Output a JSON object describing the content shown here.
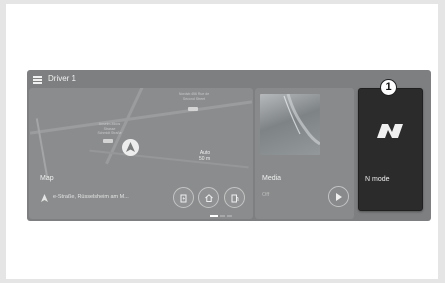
{
  "header": {
    "profile_name": "Driver 1"
  },
  "map": {
    "title": "Map",
    "route_text": "e-Straße, Rüsselsheim am M...",
    "zoom_mode": "Auto",
    "zoom_scale": "50 m",
    "poi_1": "Nordstr.456 Rue de\nSecond Street",
    "poi_2": "Anselm-Moos\nStrasse\nSchmidt Straße",
    "buttons": [
      {
        "icon": "charging-station-icon"
      },
      {
        "icon": "home-icon"
      },
      {
        "icon": "fuel-pump-icon"
      }
    ]
  },
  "media": {
    "title": "Media",
    "status": "Off"
  },
  "n_mode": {
    "label": "N mode",
    "callout": "1"
  },
  "pagination": {
    "page_count": 3,
    "active_page": 1
  },
  "colors": {
    "screen_bg": "#7d7f80",
    "n_mode_bg": "#2b2b2b",
    "text_light": "#f0f0f0",
    "active_dot": "#ffffff"
  }
}
